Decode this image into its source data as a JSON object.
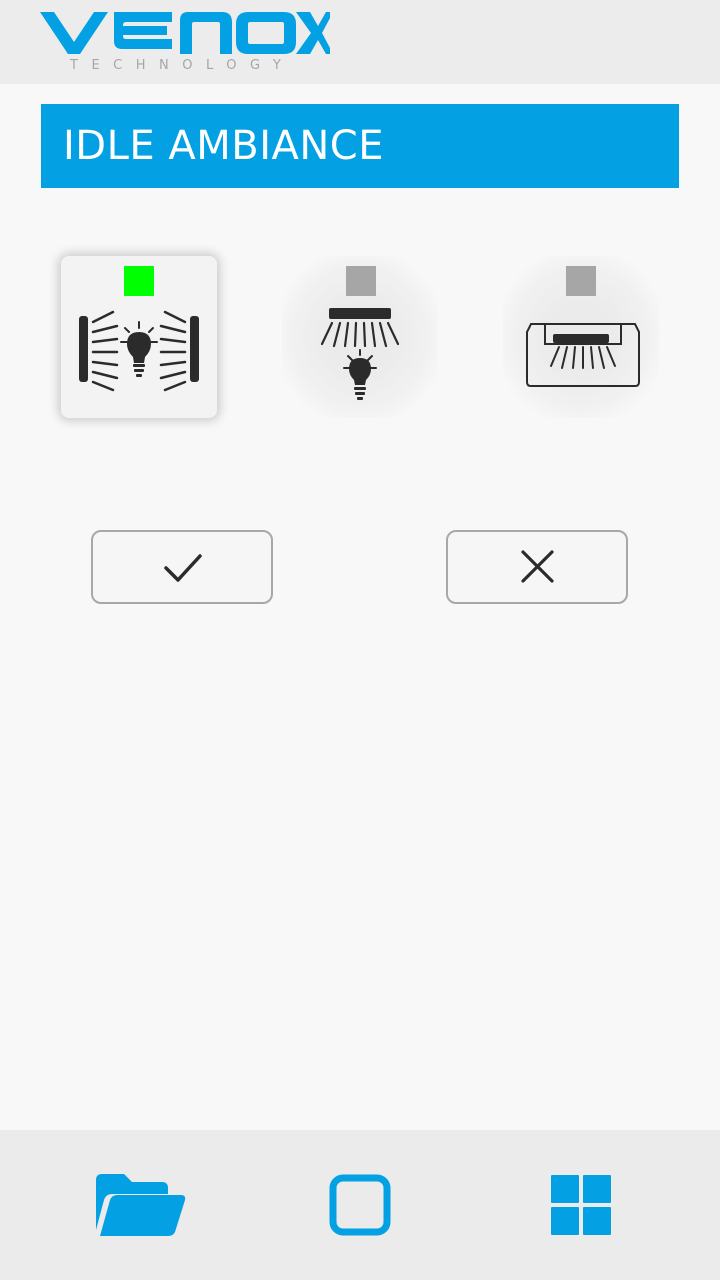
{
  "brand": {
    "logo_text": "VENOX",
    "tagline": "TECHNOLOGY",
    "color": "#03a1e3"
  },
  "title": "IDLE AMBIANCE",
  "modes": [
    {
      "icon": "side-lights-bulb-icon",
      "selected": true,
      "indicator_color": "#00ff00"
    },
    {
      "icon": "ceiling-light-bulb-icon",
      "selected": false,
      "indicator_color": "#a6a6a6"
    },
    {
      "icon": "under-cabinet-light-icon",
      "selected": false,
      "indicator_color": "#a6a6a6"
    }
  ],
  "actions": {
    "confirm_icon": "checkmark-icon",
    "cancel_icon": "close-icon"
  },
  "nav": [
    {
      "icon": "folder-icon"
    },
    {
      "icon": "square-icon"
    },
    {
      "icon": "grid-icon"
    }
  ],
  "colors": {
    "accent": "#03a1e3",
    "active_indicator": "#00ff00",
    "inactive_indicator": "#a6a6a6",
    "icon_dark": "#2b2b2b"
  }
}
